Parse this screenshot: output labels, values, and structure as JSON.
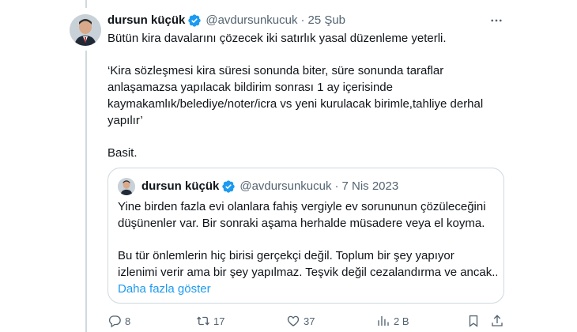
{
  "tweet": {
    "author_name": "dursun küçük",
    "handle": "@avdursunkucuk",
    "separator": "·",
    "date": "25 Şub",
    "lines": {
      "l1": "Bütün kira davalarını çözecek iki satırlık yasal düzenleme yeterli.",
      "l2": "‘Kira sözleşmesi kira süresi sonunda biter, süre sonunda taraflar",
      "l3": "anlaşamazsa yapılacak bildirim sonrası 1 ay içerisinde",
      "l4": "kaymakamlık/belediye/noter/icra vs yeni kurulacak birimle,tahliye derhal",
      "l5": "yapılır’",
      "l6": "Basit."
    }
  },
  "quote": {
    "author_name": "dursun küçük",
    "handle": "@avdursunkucuk",
    "separator": "·",
    "date": "7 Nis 2023",
    "lines": {
      "l1": "Yine birden fazla evi olanlara fahiş vergiyle ev sorununun çözüleceğini",
      "l2": "düşünenler var. Bir sonraki aşama herhalde müsadere veya el koyma.",
      "l3": "Bu tür önlemlerin hiç birisi gerçekçi değil. Toplum bir şey yapıyor",
      "l4": "izlenimi verir ama bir şey yapılmaz. Teşvik değil cezalandırma ve ancak..."
    },
    "show_more": "Daha fazla göster"
  },
  "actions": {
    "replies": "8",
    "retweets": "17",
    "likes": "37",
    "views": "2 B"
  },
  "colors": {
    "accent": "#1d9bf0",
    "text": "#0f1419",
    "muted": "#536471",
    "border": "#cfd9de"
  },
  "icons": [
    "more-icon",
    "verified-badge-icon",
    "reply-icon",
    "retweet-icon",
    "like-icon",
    "views-icon",
    "bookmark-icon",
    "share-icon"
  ]
}
